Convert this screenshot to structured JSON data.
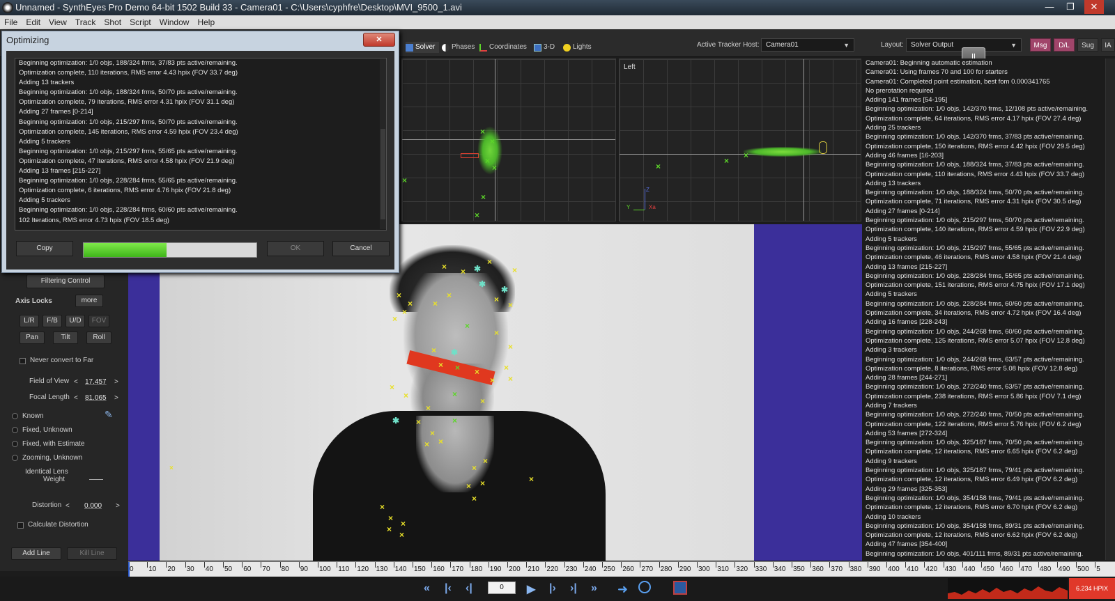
{
  "window": {
    "title": "Unnamed - SynthEyes Pro Demo 64-bit 1502 Build 33 - Camera01 - C:\\Users\\cyphfre\\Desktop\\MVI_9500_1.avi",
    "min_label": "—",
    "max_label": "❐",
    "close_label": "✕"
  },
  "menu": [
    "File",
    "Edit",
    "View",
    "Track",
    "Shot",
    "Script",
    "Window",
    "Help"
  ],
  "toolbar": {
    "tabs": [
      {
        "label": "Solver",
        "icon": "solver-icon"
      },
      {
        "label": "Phases",
        "icon": "phases-icon"
      },
      {
        "label": "Coordinates",
        "icon": "coordinates-icon"
      },
      {
        "label": "3-D",
        "icon": "cube-icon"
      },
      {
        "label": "Lights",
        "icon": "bulb-icon"
      }
    ],
    "tracker_host_label": "Active Tracker Host:",
    "tracker_host_value": "Camera01",
    "layout_label": "Layout:",
    "layout_value": "Solver Output",
    "msg": "Msg",
    "dl": "D/L",
    "sug": "Sug",
    "ia": "IA"
  },
  "viewports": {
    "left_label": "Left",
    "axis_y": "Y",
    "axis_z": "Z",
    "axis_xa": "Xa"
  },
  "dialog": {
    "title": "Optimizing",
    "close": "✕",
    "log": [
      "Beginning optimization: 1/0 objs, 188/324 frms, 37/83 pts active/remaining.",
      "Optimization complete, 110 iterations, RMS error 4.43 hpix (FOV 33.7 deg)",
      "Adding 13 trackers",
      "Beginning optimization: 1/0 objs, 188/324 frms, 50/70 pts active/remaining.",
      "Optimization complete, 79 iterations, RMS error 4.31 hpix (FOV 31.1 deg)",
      "Adding 27 frames [0-214]",
      "Beginning optimization: 1/0 objs, 215/297 frms, 50/70 pts active/remaining.",
      "Optimization complete, 145 iterations, RMS error 4.59 hpix (FOV 23.4 deg)",
      "Adding 5 trackers",
      "Beginning optimization: 1/0 objs, 215/297 frms, 55/65 pts active/remaining.",
      "Optimization complete, 47 iterations, RMS error 4.58 hpix (FOV 21.9 deg)",
      "Adding 13 frames [215-227]",
      "Beginning optimization: 1/0 objs, 228/284 frms, 55/65 pts active/remaining.",
      "Optimization complete, 6 iterations, RMS error 4.76 hpix (FOV 21.8 deg)",
      "Adding 5 trackers",
      "Beginning optimization: 1/0 objs, 228/284 frms, 60/60 pts active/remaining.",
      "102 Iterations, RMS error 4.73 hpix (FOV 18.5 deg)"
    ],
    "copy": "Copy",
    "progress": 0.48,
    "ok": "OK",
    "cancel": "Cancel"
  },
  "left_panel": {
    "filtering_control": "Filtering Control",
    "axis_locks": "Axis Locks",
    "more": "more",
    "lr": "L/R",
    "fb": "F/B",
    "ud": "U/D",
    "fov": "FOV",
    "pan": "Pan",
    "tilt": "Tilt",
    "roll": "Roll",
    "never_convert": "Never convert to Far",
    "fov_label": "Field of View",
    "fov_value": "17.457",
    "focal_label": "Focal Length",
    "focal_value": "81.065",
    "lens_modes": [
      "Known",
      "Fixed, Unknown",
      "Fixed, with Estimate",
      "Zooming, Unknown"
    ],
    "identical_lens_1": "Identical Lens",
    "identical_lens_2": "Weight",
    "distortion_label": "Distortion",
    "distortion_value": "0.000",
    "calc_distortion": "Calculate Distortion",
    "add_line": "Add Line",
    "kill_line": "Kill Line",
    "lt": "<",
    "gt": ">"
  },
  "solver_output": [
    "Camera01: Beginning automatic estimation",
    "Camera01: Using frames 70 and 100 for starters",
    "Camera01: Completed point estimation, best fom 0.000341765",
    "No prerotation required",
    "Adding 141 frames [54-195]",
    "Beginning optimization: 1/0 objs, 142/370 frms, 12/108 pts active/remaining.",
    "Optimization complete, 64 iterations, RMS error 4.17 hpix (FOV 27.4 deg)",
    "Adding 25 trackers",
    "Beginning optimization: 1/0 objs, 142/370 frms, 37/83 pts active/remaining.",
    "Optimization complete, 150 iterations, RMS error 4.42 hpix (FOV 29.5 deg)",
    "Adding 46 frames [16-203]",
    "Beginning optimization: 1/0 objs, 188/324 frms, 37/83 pts active/remaining.",
    "Optimization complete, 110 iterations, RMS error 4.43 hpix (FOV 33.7 deg)",
    "Adding 13 trackers",
    "Beginning optimization: 1/0 objs, 188/324 frms, 50/70 pts active/remaining.",
    "Optimization complete, 71 iterations, RMS error 4.31 hpix (FOV 30.5 deg)",
    "Adding 27 frames [0-214]",
    "Beginning optimization: 1/0 objs, 215/297 frms, 50/70 pts active/remaining.",
    "Optimization complete, 140 iterations, RMS error 4.59 hpix (FOV 22.9 deg)",
    "Adding 5 trackers",
    "Beginning optimization: 1/0 objs, 215/297 frms, 55/65 pts active/remaining.",
    "Optimization complete, 46 iterations, RMS error 4.58 hpix (FOV 21.4 deg)",
    "Adding 13 frames [215-227]",
    "Beginning optimization: 1/0 objs, 228/284 frms, 55/65 pts active/remaining.",
    "Optimization complete, 151 iterations, RMS error 4.75 hpix (FOV 17.1 deg)",
    "Adding 5 trackers",
    "Beginning optimization: 1/0 objs, 228/284 frms, 60/60 pts active/remaining.",
    "Optimization complete, 34 iterations, RMS error 4.72 hpix (FOV 16.4 deg)",
    "Adding 16 frames [228-243]",
    "Beginning optimization: 1/0 objs, 244/268 frms, 60/60 pts active/remaining.",
    "Optimization complete, 125 iterations, RMS error 5.07 hpix (FOV 12.8 deg)",
    "Adding 3 trackers",
    "Beginning optimization: 1/0 objs, 244/268 frms, 63/57 pts active/remaining.",
    "Optimization complete, 8 iterations, RMS error 5.08 hpix (FOV 12.8 deg)",
    "Adding 28 frames [244-271]",
    "Beginning optimization: 1/0 objs, 272/240 frms, 63/57 pts active/remaining.",
    "Optimization complete, 238 iterations, RMS error 5.86 hpix (FOV 7.1 deg)",
    "Adding 7 trackers",
    "Beginning optimization: 1/0 objs, 272/240 frms, 70/50 pts active/remaining.",
    "Optimization complete, 122 iterations, RMS error 5.76 hpix (FOV 6.2 deg)",
    "Adding 53 frames [272-324]",
    "Beginning optimization: 1/0 objs, 325/187 frms, 70/50 pts active/remaining.",
    "Optimization complete, 12 iterations, RMS error 6.65 hpix (FOV 6.2 deg)",
    "Adding 9 trackers",
    "Beginning optimization: 1/0 objs, 325/187 frms, 79/41 pts active/remaining.",
    "Optimization complete, 12 iterations, RMS error 6.49 hpix (FOV 6.2 deg)",
    "Adding 29 frames [325-353]",
    "Beginning optimization: 1/0 objs, 354/158 frms, 79/41 pts active/remaining.",
    "Optimization complete, 12 iterations, RMS error 6.70 hpix (FOV 6.2 deg)",
    "Adding 10 trackers",
    "Beginning optimization: 1/0 objs, 354/158 frms, 89/31 pts active/remaining.",
    "Optimization complete, 12 iterations, RMS error 6.62 hpix (FOV 6.2 deg)",
    "Adding 47 frames [354-400]",
    "Beginning optimization: 1/0 objs, 401/111 frms, 89/31 pts active/remaining."
  ],
  "timeline": {
    "ticks": [
      "0",
      "10",
      "20",
      "30",
      "40",
      "50",
      "60",
      "70",
      "80",
      "90",
      "100",
      "110",
      "120",
      "130",
      "140",
      "150",
      "160",
      "170",
      "180",
      "190",
      "200",
      "210",
      "220",
      "230",
      "240",
      "250",
      "260",
      "270",
      "280",
      "290",
      "300",
      "310",
      "320",
      "330",
      "340",
      "350",
      "360",
      "370",
      "380",
      "390",
      "400",
      "410",
      "420",
      "430",
      "440",
      "450",
      "460",
      "470",
      "480",
      "490",
      "500",
      "5"
    ],
    "current_frame": "0"
  },
  "transport": {
    "rewind": "«",
    "to_start": "|‹",
    "step_back": "‹|",
    "play": "▶",
    "step_fwd": "|›",
    "to_end": "›|",
    "ffwd": "»"
  },
  "error_readout": "6.234 HPIX",
  "colors": {
    "accent_pink": "#a0456a",
    "tracker_yellow": "#e8e02a",
    "tracker_green": "#5dd62a",
    "frame_blue": "#3b2f9a",
    "red_bar": "#e0381f"
  }
}
